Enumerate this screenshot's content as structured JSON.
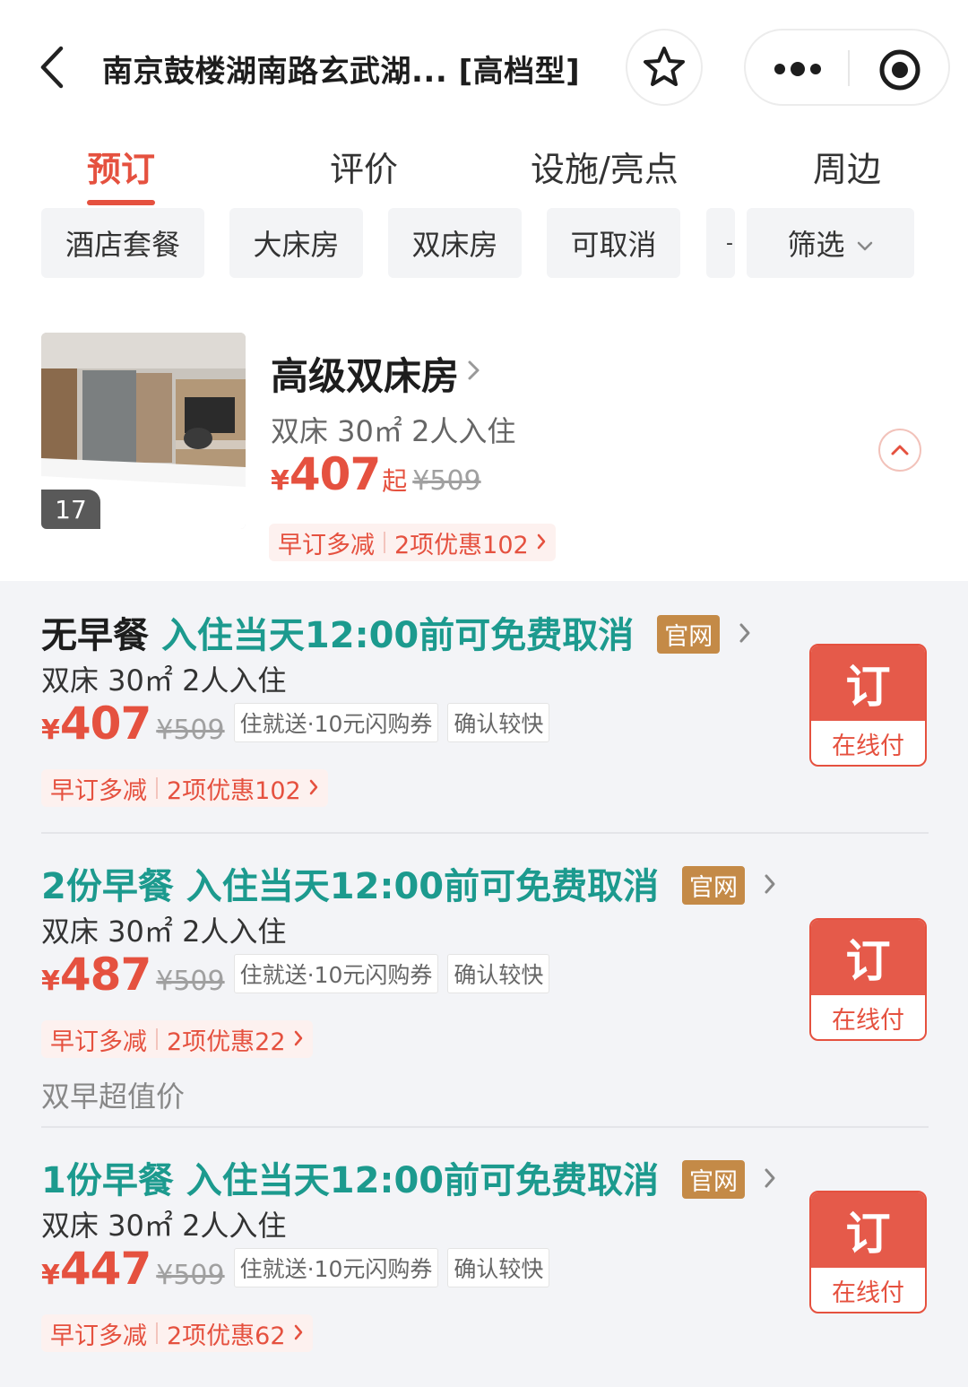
{
  "header": {
    "title": "南京鼓楼湖南路玄武湖... [高档型]",
    "favorite_icon": "star-icon",
    "more_icon": "more-dots-icon",
    "target_icon": "record-target-icon"
  },
  "tabs": [
    {
      "label": "预订",
      "active": true
    },
    {
      "label": "评价",
      "active": false
    },
    {
      "label": "设施/亮点",
      "active": false
    },
    {
      "label": "周边",
      "active": false
    }
  ],
  "filters": {
    "chips": [
      "酒店套餐",
      "大床房",
      "双床房",
      "可取消"
    ],
    "partial_chip": "-",
    "screen_label": "筛选"
  },
  "room": {
    "name": "高级双床房",
    "image_count": "17",
    "spec": "双床 30㎡ 2人入住",
    "currency": "¥",
    "price": "407",
    "price_suffix": "起",
    "original_price": "¥509",
    "promo_left": "早订多减",
    "promo_right": "2项优惠102"
  },
  "rates": [
    {
      "meal": "无早餐",
      "cancel": "入住当天12:00前可免费取消",
      "badge": "官网",
      "spec": "双床 30㎡ 2人入住",
      "currency": "¥",
      "price": "407",
      "original_price": "¥509",
      "tag1": "住就送·10元闪购券",
      "tag2": "确认较快",
      "promo_left": "早订多减",
      "promo_right": "2项优惠102",
      "note": "",
      "book_label": "订",
      "pay_label": "在线付"
    },
    {
      "meal": "2份早餐",
      "cancel": "入住当天12:00前可免费取消",
      "badge": "官网",
      "spec": "双床 30㎡ 2人入住",
      "currency": "¥",
      "price": "487",
      "original_price": "¥509",
      "tag1": "住就送·10元闪购券",
      "tag2": "确认较快",
      "promo_left": "早订多减",
      "promo_right": "2项优惠22",
      "note": "双早超值价",
      "book_label": "订",
      "pay_label": "在线付"
    },
    {
      "meal": "1份早餐",
      "cancel": "入住当天12:00前可免费取消",
      "badge": "官网",
      "spec": "双床 30㎡ 2人入住",
      "currency": "¥",
      "price": "447",
      "original_price": "¥509",
      "tag1": "住就送·10元闪购券",
      "tag2": "确认较快",
      "promo_left": "早订多减",
      "promo_right": "2项优惠62",
      "note": "",
      "book_label": "订",
      "pay_label": "在线付"
    }
  ],
  "colors": {
    "accent": "#e5513f",
    "teal": "#1c9a8e",
    "badge": "#c48a47",
    "page_bg": "#f3f4f7"
  }
}
